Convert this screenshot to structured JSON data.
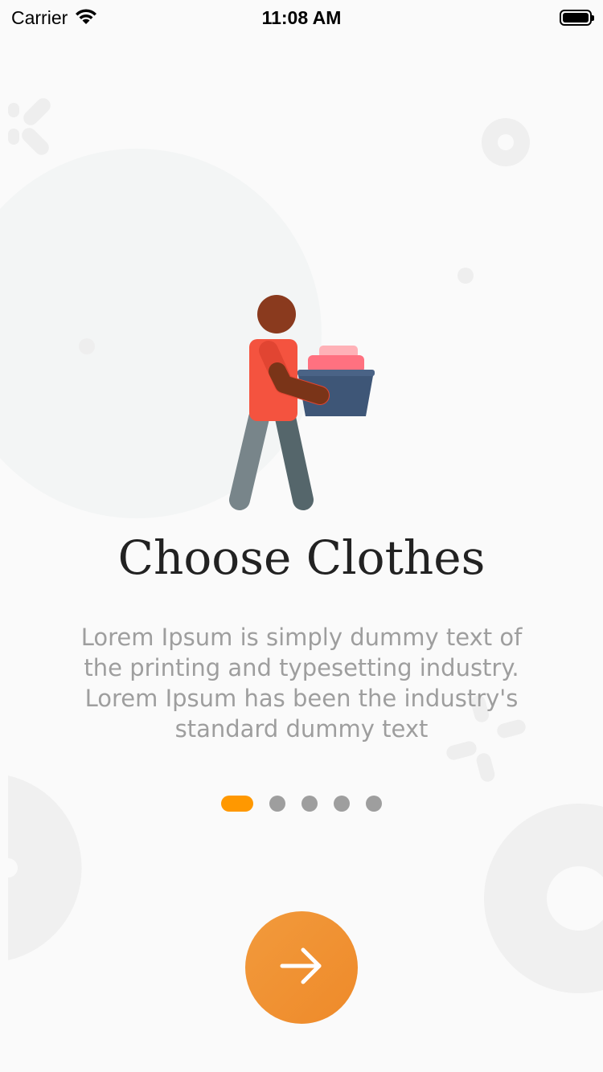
{
  "status_bar": {
    "carrier": "Carrier",
    "time": "11:08 AM"
  },
  "onboarding": {
    "title": "Choose Clothes",
    "description": "Lorem Ipsum is simply dummy text of the printing and typesetting industry. Lorem Ipsum has been the industry's standard dummy text",
    "page_indicator": {
      "total": 5,
      "current": 1
    },
    "next_button": {
      "icon": "arrow-right-icon"
    },
    "illustration": "person-carrying-laundry-basket"
  },
  "colors": {
    "accent": "#FF9800",
    "button": "#F0922F",
    "background": "#FAFAFA",
    "inactive_dot": "#9E9E9E"
  }
}
